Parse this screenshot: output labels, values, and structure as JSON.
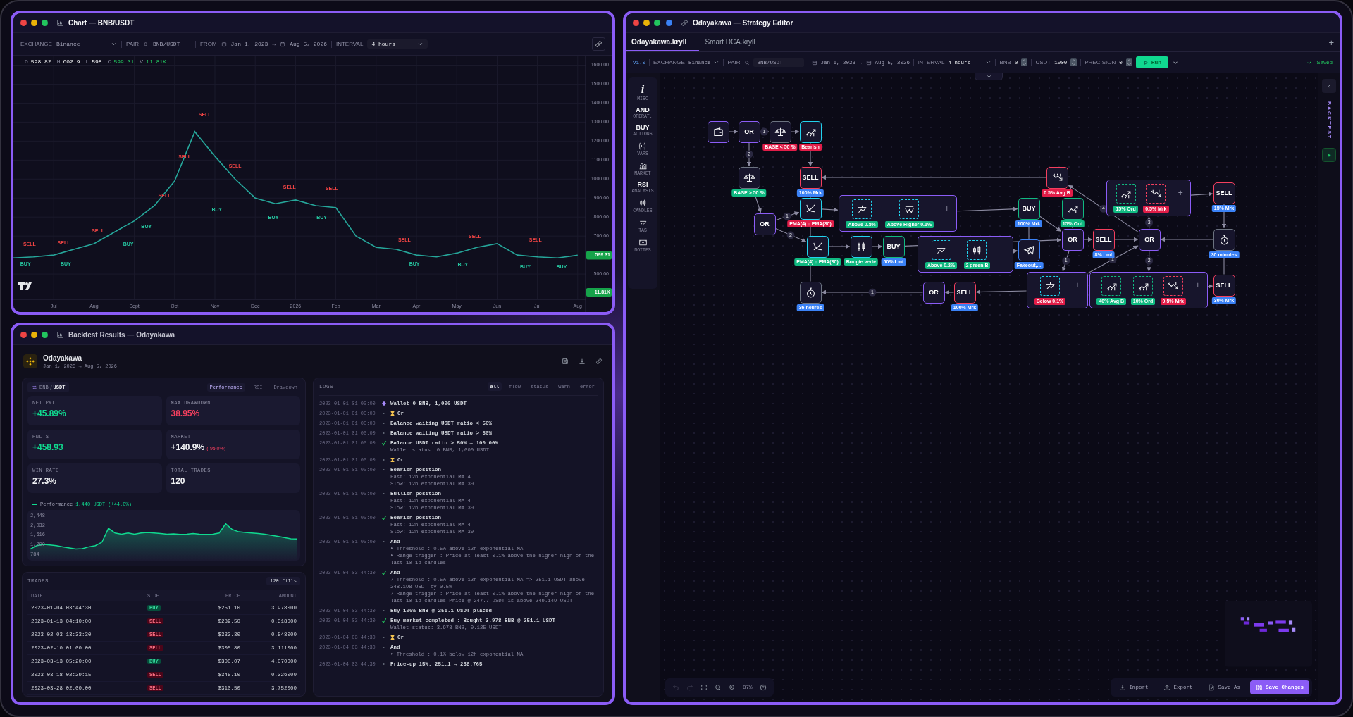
{
  "chart_window": {
    "title": "Chart — BNB/USDT",
    "toolbar": {
      "exchange_label": "EXCHANGE",
      "exchange": "Binance",
      "pair_label": "PAIR",
      "pair": "BNB/USDT",
      "from_label": "FROM",
      "from": "Jan 1, 2023",
      "arrow": "→",
      "to": "Aug 5, 2026",
      "interval_label": "INTERVAL",
      "interval": "4 hours"
    },
    "ohlc": [
      {
        "key": "O",
        "value": "598.82",
        "kind": "plain"
      },
      {
        "key": "H",
        "value": "602.9",
        "kind": "plain"
      },
      {
        "key": "L",
        "value": "598",
        "kind": "plain"
      },
      {
        "key": "C",
        "value": "599.31",
        "kind": "up"
      },
      {
        "key": "V",
        "value": "11.81K",
        "kind": "up"
      }
    ],
    "last_price": "599.31",
    "last_volume": "11.81K",
    "chart_data": {
      "type": "line",
      "categories": [
        null,
        null,
        "Jul",
        null,
        "Aug",
        null,
        "Sept",
        null,
        "Oct",
        null,
        "Nov",
        null,
        "Dec",
        null,
        "2026",
        null,
        "Feb",
        null,
        "Mar",
        null,
        "Apr",
        null,
        "May",
        null,
        "Jun",
        null,
        "Jul",
        null,
        "Aug"
      ],
      "series": [
        {
          "color": "#26a69a",
          "values": [
            585,
            590,
            600,
            630,
            660,
            720,
            780,
            860,
            990,
            1250,
            1120,
            1000,
            900,
            870,
            890,
            860,
            850,
            700,
            640,
            630,
            600,
            590,
            610,
            640,
            660,
            600,
            590,
            585,
            599
          ]
        }
      ],
      "ylim": [
        300,
        1650
      ],
      "grid": true,
      "yticks": [
        {
          "value": 500,
          "label": "500.00"
        },
        {
          "value": 700,
          "label": "700.00"
        },
        {
          "value": 800,
          "label": "800.00"
        },
        {
          "value": 900,
          "label": "900.00"
        },
        {
          "value": 1000,
          "label": "1000.00"
        },
        {
          "value": 1100,
          "label": "1100.00"
        },
        {
          "value": 1200,
          "label": "1200.00"
        },
        {
          "value": 1300,
          "label": "1300.00"
        },
        {
          "value": 1400,
          "label": "1400.00"
        },
        {
          "value": 1500,
          "label": "1500.00"
        },
        {
          "value": 1600,
          "label": "1600.00"
        }
      ]
    },
    "markers": [
      {
        "text": "SELL",
        "kind": "sell"
      },
      {
        "text": "BUY",
        "kind": "buy"
      },
      {
        "text": "SELL",
        "kind": "sell"
      },
      {
        "text": "BUY",
        "kind": "buy"
      },
      {
        "text": "SELL",
        "kind": "sell"
      },
      {
        "text": "BUY",
        "kind": "buy"
      },
      {
        "text": "SELL",
        "kind": "sell"
      },
      {
        "text": "BUY",
        "kind": "buy"
      },
      {
        "text": "SELL",
        "kind": "sell"
      },
      {
        "text": "SELL",
        "kind": "sell"
      },
      {
        "text": "BUY",
        "kind": "buy"
      },
      {
        "text": "SELL",
        "kind": "sell"
      },
      {
        "text": "BUY",
        "kind": "buy"
      },
      {
        "text": "SELL",
        "kind": "sell"
      },
      {
        "text": "BUY",
        "kind": "buy"
      },
      {
        "text": "SELL",
        "kind": "sell"
      },
      {
        "text": "SELL",
        "kind": "sell"
      },
      {
        "text": "BUY",
        "kind": "buy"
      },
      {
        "text": "SELL",
        "kind": "sell"
      },
      {
        "text": "BUY",
        "kind": "buy"
      },
      {
        "text": "SELL",
        "kind": "sell"
      },
      {
        "text": "BUY",
        "kind": "buy"
      },
      {
        "text": "BUY",
        "kind": "buy"
      }
    ]
  },
  "backtest": {
    "title": "Backtest Results — Odayakawa",
    "strategy": "Odayakawa",
    "period": "Jan 1, 2023 → Aug 5, 2026",
    "pair": [
      {
        "label": "BNB",
        "selected": false
      },
      {
        "label": "USDT",
        "selected": true
      }
    ],
    "views": [
      {
        "label": "Performance",
        "selected": true
      },
      {
        "label": "ROI",
        "selected": false
      },
      {
        "label": "Drawdown",
        "selected": false
      }
    ],
    "stats": [
      {
        "label": "NET P&L",
        "value": "+45.89%",
        "color": "#10d98f"
      },
      {
        "label": "MAX DRAWDOWN",
        "value": "38.95%",
        "color": "#f43f5e"
      },
      {
        "label": "PNL $",
        "value": "+458.93",
        "color": "#10d98f"
      },
      {
        "label": "MARKET",
        "value": "+140.9%",
        "note": "(-95.0%)",
        "color": "#f3f4f6"
      },
      {
        "label": "WIN RATE",
        "value": "27.3%",
        "color": "#f3f4f6"
      },
      {
        "label": "TOTAL TRADES",
        "value": "120",
        "color": "#f3f4f6"
      }
    ],
    "performance": {
      "legend_value": "1,440 USDT",
      "legend_change": "(+44.0%)",
      "chart_data": {
        "type": "area",
        "ylim": [
          500,
          2700
        ],
        "yticks": [
          {
            "value": 784,
            "label": "784"
          },
          {
            "value": 1200,
            "label": "1,200"
          },
          {
            "value": 1616,
            "label": "1,616"
          },
          {
            "value": 2032,
            "label": "2,032"
          },
          {
            "value": 2448,
            "label": "2,448"
          }
        ],
        "series": [
          {
            "name": "Performance",
            "color": "#10d98f",
            "values": [
              1000,
              1150,
              1200,
              1180,
              1150,
              1100,
              1050,
              1000,
              1020,
              1100,
              1150,
              1300,
              1900,
              1700,
              1650,
              1700,
              1650,
              1700,
              1720,
              1700,
              1680,
              1650,
              1660,
              1640,
              1650,
              1680,
              1650,
              1640,
              1650,
              1700,
              2100,
              1850,
              1750,
              1720,
              1700,
              1680,
              1650,
              1600,
              1550,
              1500,
              1450,
              1440
            ]
          }
        ]
      }
    },
    "trades": {
      "title": "TRADES",
      "count": "120 fills",
      "columns": [
        "DATE",
        "SIDE",
        "PRICE",
        "AMOUNT"
      ],
      "rows": [
        {
          "date": "2023-01-04 03:44:30",
          "side": "BUY",
          "kind": "buy",
          "price": "$251.10",
          "amount": "3.978000"
        },
        {
          "date": "2023-01-13 04:10:00",
          "side": "SELL",
          "kind": "sell",
          "price": "$289.50",
          "amount": "0.318000"
        },
        {
          "date": "2023-02-03 13:33:30",
          "side": "SELL",
          "kind": "sell",
          "price": "$333.30",
          "amount": "0.548000"
        },
        {
          "date": "2023-02-10 01:00:00",
          "side": "SELL",
          "kind": "sell",
          "price": "$305.80",
          "amount": "3.111000"
        },
        {
          "date": "2023-03-13 05:20:00",
          "side": "BUY",
          "kind": "buy",
          "price": "$300.07",
          "amount": "4.070000"
        },
        {
          "date": "2023-03-18 02:29:15",
          "side": "SELL",
          "kind": "sell",
          "price": "$345.10",
          "amount": "0.326000"
        },
        {
          "date": "2023-03-28 02:00:00",
          "side": "SELL",
          "kind": "sell",
          "price": "$310.50",
          "amount": "3.752000"
        }
      ]
    },
    "logs": {
      "title": "LOGS",
      "filters": [
        {
          "label": "all",
          "selected": true
        },
        {
          "label": "flow",
          "selected": false
        },
        {
          "label": "status",
          "selected": false
        },
        {
          "label": "warn",
          "selected": false
        },
        {
          "label": "error",
          "selected": false
        }
      ],
      "entries": [
        {
          "time": "2023-01-01 01:00:00",
          "kind": "wallet",
          "text": "Wallet 0 BNB, 1,000 USDT"
        },
        {
          "time": "2023-01-01 01:00:00",
          "kind": "step",
          "wait": true,
          "text": "Or"
        },
        {
          "time": "2023-01-01 01:00:00",
          "kind": "step",
          "text": "Balance waiting USDT ratio < 50%"
        },
        {
          "time": "2023-01-01 01:00:00",
          "kind": "step",
          "text": "Balance waiting USDT ratio > 50%"
        },
        {
          "time": "2023-01-01 01:00:00",
          "kind": "check",
          "text": "Balance USDT ratio > 50% → 100.00%",
          "details": [
            "Wallet status: 0 BNB, 1,000 USDT"
          ]
        },
        {
          "time": "2023-01-01 01:00:00",
          "kind": "step",
          "wait": true,
          "text": "Or"
        },
        {
          "time": "2023-01-01 01:00:00",
          "kind": "step",
          "text": "Bearish position",
          "details": [
            "Fast: 12h exponential MA 4",
            "Slow: 12h exponential MA 30"
          ]
        },
        {
          "time": "2023-01-01 01:00:00",
          "kind": "step",
          "text": "Bullish position",
          "details": [
            "Fast: 12h exponential MA 4",
            "Slow: 12h exponential MA 30"
          ]
        },
        {
          "time": "2023-01-01 01:00:00",
          "kind": "check",
          "text": "Bearish position",
          "details": [
            "Fast: 12h exponential MA 4",
            "Slow: 12h exponential MA 30"
          ]
        },
        {
          "time": "2023-01-01 01:00:00",
          "kind": "step",
          "text": "And",
          "details": [
            "‣ Threshold : 0.5% above 12h exponential MA",
            "‣ Range-trigger : Price at least 0.1% above the higher high of the last 10 1d candles"
          ]
        },
        {
          "time": "2023-01-04 03:44:30",
          "kind": "check",
          "text": "And",
          "details": [
            "✓ Threshold : 0.5% above 12h exponential MA => 251.1 USDT above 248.198 USDT by 0.5%",
            "✓ Range-trigger : Price at least 0.1% above the higher high of the last 10 1d candles Price @ 247.7 USDT is above 249.149 USDT"
          ]
        },
        {
          "time": "2023-01-04 03:44:30",
          "kind": "step",
          "text": "Buy 100% BNB @ 251.1 USDT placed"
        },
        {
          "time": "2023-01-04 03:44:30",
          "kind": "check",
          "text": "Buy market completed : Bought 3.978 BNB @ 251.1 USDT",
          "details": [
            "Wallet status: 3.978 BNB, 0.125 USDT"
          ]
        },
        {
          "time": "2023-01-04 03:44:30",
          "kind": "step",
          "wait": true,
          "text": "Or"
        },
        {
          "time": "2023-01-04 03:44:30",
          "kind": "step",
          "text": "And",
          "details": [
            "‣ Threshold : 0.1% below 12h exponential MA"
          ]
        },
        {
          "time": "2023-01-04 03:44:30",
          "kind": "step",
          "text": "Price-up 15%: 251.1 → 288.765"
        }
      ]
    }
  },
  "editor": {
    "title": "Odayakawa — Strategy Editor",
    "tabs": [
      {
        "label": "Odayakawa.kryll",
        "selected": true
      },
      {
        "label": "Smart DCA.kryll",
        "selected": false
      }
    ],
    "add_tab": "+",
    "toolbar": {
      "version": "v1.0",
      "exchange_label": "EXCHANGE",
      "exchange": "Binance",
      "pair_label": "PAIR",
      "pair": "BNB/USDT",
      "from": "Jan 1, 2023",
      "arrow": "→",
      "to": "Aug 5, 2026",
      "interval_label": "INTERVAL",
      "interval": "4 hours",
      "steppers": [
        {
          "label": "BNB",
          "value": "0"
        },
        {
          "label": "USDT",
          "value": "1000"
        },
        {
          "label": "PRECISION",
          "value": "0"
        }
      ],
      "run": "Run",
      "status": "Saved"
    },
    "palette": [
      {
        "kind": "glyph",
        "glyph": "i",
        "label": "MISC"
      },
      {
        "kind": "glyph",
        "glyph": "AND",
        "label": "OPERAT."
      },
      {
        "kind": "glyph",
        "glyph": "BUY",
        "label": "ACTIONS"
      },
      {
        "kind": "icon",
        "label": "VARS"
      },
      {
        "kind": "icon",
        "label": "MARKET"
      },
      {
        "kind": "glyph",
        "glyph": "RSI",
        "label": "ANALYSIS"
      },
      {
        "kind": "icon",
        "label": "CANDLES"
      },
      {
        "kind": "icon",
        "label": "TAS"
      },
      {
        "kind": "icon",
        "label": "NOTIFS"
      }
    ],
    "side_panel": {
      "label": "BACKTEST"
    },
    "nodes": [
      {
        "kind": "icon",
        "color": "#8b5cf6"
      },
      {
        "kind": "op",
        "text": "OR",
        "color": "#8b5cf6"
      },
      {
        "kind": "icon",
        "color": "#6b7280",
        "tag": {
          "text": "BASE < 50 %",
          "color": "#e11d48"
        }
      },
      {
        "kind": "icon",
        "color": "#22d3ee",
        "tag": {
          "text": "Bearish",
          "color": "#e11d48"
        }
      },
      {
        "kind": "icon",
        "color": "#6b7280",
        "tag": {
          "text": "BASE > 50 %",
          "color": "#10b981"
        }
      },
      {
        "kind": "action",
        "text": "SELL",
        "color": "#f43f5e",
        "tag": {
          "text": "100% Mrk",
          "color": "#3b82f6"
        }
      },
      {
        "kind": "op",
        "text": "OR",
        "color": "#8b5cf6"
      },
      {
        "kind": "icon",
        "color": "#22d3ee",
        "tag": {
          "text": "EMA(4) ↓ EMA(30)",
          "color": "#e11d48"
        }
      },
      {
        "kind": "group",
        "color": "#8b5cf6",
        "add": "+",
        "items": [
          {
            "color": "#22d3ee",
            "tag": {
              "text": "Above 0.5%",
              "color": "#10b981"
            }
          },
          {
            "color": "#22d3ee",
            "tag": {
              "text": "Above Higher 0.1%",
              "color": "#10b981"
            }
          }
        ]
      },
      {
        "kind": "icon",
        "color": "#22d3ee",
        "tag": {
          "text": "EMA(4) ↑ EMA(30)",
          "color": "#10b981"
        }
      },
      {
        "kind": "icon",
        "color": "#22d3ee",
        "tag": {
          "text": "Bougie verte",
          "color": "#10b981"
        }
      },
      {
        "kind": "action",
        "text": "BUY",
        "color": "#10b981",
        "tag": {
          "text": "50% Lmt",
          "color": "#3b82f6"
        }
      },
      {
        "kind": "group",
        "color": "#8b5cf6",
        "add": "+",
        "items": [
          {
            "color": "#22d3ee",
            "tag": {
              "text": "Above 0.2%",
              "color": "#10b981"
            }
          },
          {
            "color": "#22d3ee",
            "tag": {
              "text": "2 green B",
              "color": "#10b981"
            }
          }
        ]
      },
      {
        "kind": "icon",
        "color": "#3b82f6",
        "tag": {
          "text": "Fakeout,...",
          "color": "#3b82f6"
        }
      },
      {
        "kind": "action",
        "text": "BUY",
        "color": "#10b981",
        "tag": {
          "text": "100% Mrk",
          "color": "#3b82f6"
        }
      },
      {
        "kind": "icon",
        "color": "#10b981",
        "tag": {
          "text": "15% Ord",
          "color": "#10b981"
        }
      },
      {
        "kind": "icon",
        "color": "#f43f5e",
        "tag": {
          "text": "0.5% Avg B",
          "color": "#e11d48"
        }
      },
      {
        "kind": "op",
        "text": "OR",
        "color": "#8b5cf6"
      },
      {
        "kind": "action",
        "text": "SELL",
        "color": "#f43f5e",
        "tag": {
          "text": "8% Lmt",
          "color": "#3b82f6"
        }
      },
      {
        "kind": "group",
        "color": "#8b5cf6",
        "add": "+",
        "items": [
          {
            "color": "#10b981",
            "tag": {
              "text": "15% Ord",
              "color": "#10b981"
            }
          },
          {
            "color": "#f43f5e",
            "tag": {
              "text": "0.5% Mrk",
              "color": "#e11d48"
            }
          }
        ]
      },
      {
        "kind": "op",
        "text": "OR",
        "color": "#8b5cf6"
      },
      {
        "kind": "action",
        "text": "SELL",
        "color": "#f43f5e",
        "tag": {
          "text": "15% Mrk",
          "color": "#3b82f6"
        }
      },
      {
        "kind": "icon",
        "color": "#6b7280",
        "tag": {
          "text": "30 minutes",
          "color": "#3b82f6"
        }
      },
      {
        "kind": "icon",
        "color": "#6b7280",
        "tag": {
          "text": "36 heures",
          "color": "#3b82f6"
        }
      },
      {
        "kind": "op",
        "text": "OR",
        "color": "#8b5cf6"
      },
      {
        "kind": "action",
        "text": "SELL",
        "color": "#f43f5e",
        "tag": {
          "text": "100% Mrk",
          "color": "#3b82f6"
        }
      },
      {
        "kind": "group",
        "color": "#8b5cf6",
        "add": "+",
        "items": [
          {
            "color": "#22d3ee",
            "tag": {
              "text": "Below 0.1%",
              "color": "#e11d48"
            }
          }
        ]
      },
      {
        "kind": "group",
        "color": "#8b5cf6",
        "add": "+",
        "items": [
          {
            "color": "#10b981",
            "tag": {
              "text": "40% Avg B",
              "color": "#10b981"
            }
          },
          {
            "color": "#10b981",
            "tag": {
              "text": "10% Ord",
              "color": "#10b981"
            }
          },
          {
            "color": "#f43f5e",
            "tag": {
              "text": "0.5% Mrk",
              "color": "#e11d48"
            }
          }
        ]
      },
      {
        "kind": "action",
        "text": "SELL",
        "color": "#f43f5e",
        "tag": {
          "text": "30% Mrk",
          "color": "#3b82f6"
        }
      }
    ],
    "edge_labels": [
      "1",
      "2",
      "1",
      "2",
      "1",
      "3",
      "4",
      "1",
      "2",
      "1"
    ],
    "tools": [
      {
        "kind": "undo",
        "disabled": true
      },
      {
        "kind": "redo",
        "disabled": true
      },
      {
        "kind": "fit",
        "disabled": false
      },
      {
        "kind": "zoomout",
        "disabled": false
      },
      {
        "kind": "zoomin",
        "disabled": false
      }
    ],
    "zoom": "87%",
    "actions": [
      {
        "label": "Import",
        "primary": false
      },
      {
        "label": "Export",
        "primary": false
      },
      {
        "label": "Save As",
        "primary": false
      },
      {
        "label": "Save Changes",
        "primary": true
      }
    ]
  }
}
